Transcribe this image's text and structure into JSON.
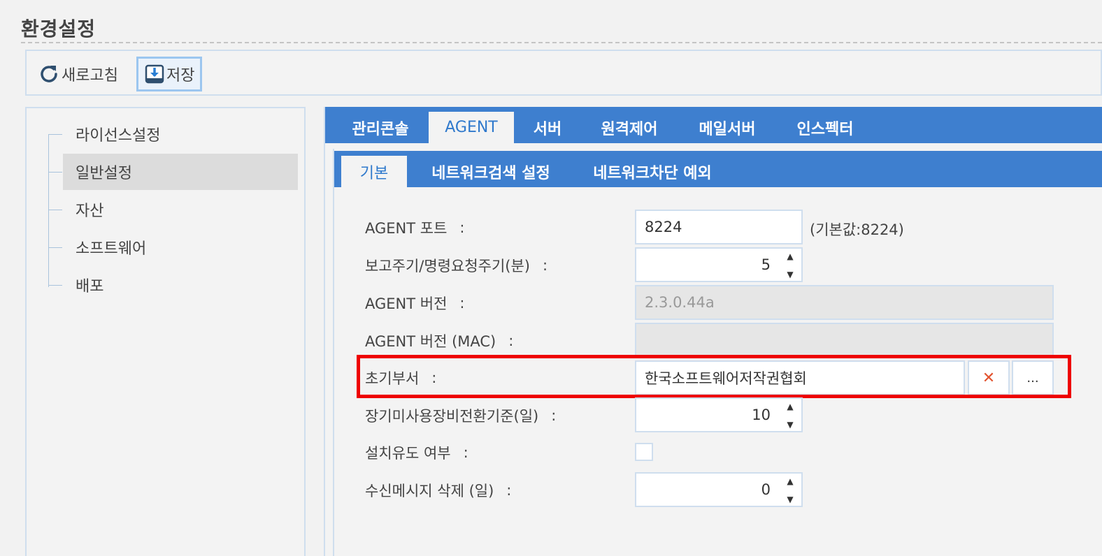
{
  "page": {
    "title": "환경설정"
  },
  "toolbar": {
    "refresh_label": "새로고침",
    "save_label": "저장"
  },
  "tree": {
    "items": [
      {
        "label": "라이선스설정",
        "selected": false
      },
      {
        "label": "일반설정",
        "selected": true
      },
      {
        "label": "자산",
        "selected": false
      },
      {
        "label": "소프트웨어",
        "selected": false
      },
      {
        "label": "배포",
        "selected": false
      }
    ]
  },
  "tabs": [
    {
      "label": "관리콘솔",
      "active": false
    },
    {
      "label": "AGENT",
      "active": true
    },
    {
      "label": "서버",
      "active": false
    },
    {
      "label": "원격제어",
      "active": false
    },
    {
      "label": "메일서버",
      "active": false
    },
    {
      "label": "인스펙터",
      "active": false
    }
  ],
  "subtabs": [
    {
      "label": "기본",
      "active": true
    },
    {
      "label": "네트워크검색 설정",
      "active": false
    },
    {
      "label": "네트워크차단 예외",
      "active": false
    }
  ],
  "form": {
    "agent_port": {
      "label": "AGENT 포트",
      "colon": ":",
      "value": "8224",
      "hint": "(기본값:8224)"
    },
    "report_cycle": {
      "label": "보고주기/명령요청주기(분)",
      "colon": ":",
      "value": "5"
    },
    "agent_version": {
      "label": "AGENT 버전",
      "colon": ":",
      "value": "2.3.0.44a"
    },
    "agent_version_mac": {
      "label": "AGENT 버전 (MAC)",
      "colon": ":",
      "value": ""
    },
    "initial_dept": {
      "label": "초기부서",
      "colon": ":",
      "value": "한국소프트웨어저작권협회",
      "clear_icon": "✕",
      "browse_label": "..."
    },
    "long_unused": {
      "label": "장기미사용장비전환기준(일)",
      "colon": ":",
      "value": "10"
    },
    "install_induce": {
      "label": "설치유도 여부",
      "colon": ":",
      "checked": false
    },
    "msg_delete": {
      "label": "수신메시지 삭제 (일)",
      "colon": ":",
      "value": "0"
    }
  },
  "spinner": {
    "up": "▲",
    "down": "▼"
  },
  "colors": {
    "tab_bar": "#3e7fcf",
    "active_tab_text": "#2f79cc",
    "highlight_border": "#ee0000",
    "clear_icon": "#e2532f"
  }
}
